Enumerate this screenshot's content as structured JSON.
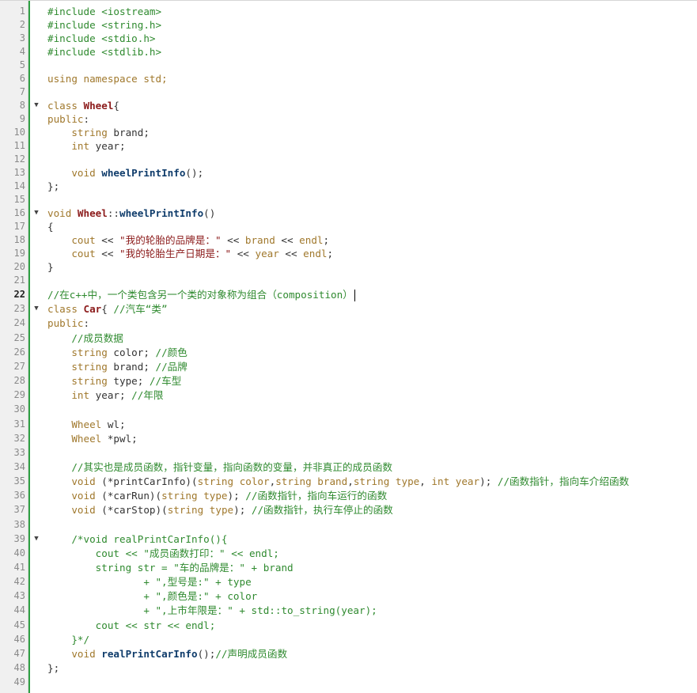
{
  "editor": {
    "current_line": 22,
    "folds": [
      8,
      16,
      23,
      39
    ],
    "lines": [
      [
        {
          "t": "#include <iostream>",
          "c": "pp"
        }
      ],
      [
        {
          "t": "#include <string.h>",
          "c": "pp"
        }
      ],
      [
        {
          "t": "#include <stdio.h>",
          "c": "pp"
        }
      ],
      [
        {
          "t": "#include <stdlib.h>",
          "c": "pp"
        }
      ],
      [],
      [
        {
          "t": "using namespace std;",
          "c": "kw"
        }
      ],
      [],
      [
        {
          "t": "class ",
          "c": "kw"
        },
        {
          "t": "Wheel",
          "c": "cls"
        },
        {
          "t": "{",
          "c": ""
        }
      ],
      [
        {
          "t": "public",
          "c": "kw"
        },
        {
          "t": ":",
          "c": ""
        }
      ],
      [
        {
          "t": "    ",
          "c": ""
        },
        {
          "t": "string",
          "c": "type"
        },
        {
          "t": " brand;",
          "c": ""
        }
      ],
      [
        {
          "t": "    ",
          "c": ""
        },
        {
          "t": "int",
          "c": "type"
        },
        {
          "t": " year;",
          "c": ""
        }
      ],
      [],
      [
        {
          "t": "    ",
          "c": ""
        },
        {
          "t": "void ",
          "c": "type"
        },
        {
          "t": "wheelPrintInfo",
          "c": "fn"
        },
        {
          "t": "();",
          "c": ""
        }
      ],
      [
        {
          "t": "};",
          "c": ""
        }
      ],
      [],
      [
        {
          "t": "void ",
          "c": "type"
        },
        {
          "t": "Wheel",
          "c": "cls"
        },
        {
          "t": "::",
          "c": ""
        },
        {
          "t": "wheelPrintInfo",
          "c": "fn"
        },
        {
          "t": "()",
          "c": ""
        }
      ],
      [
        {
          "t": "{",
          "c": ""
        }
      ],
      [
        {
          "t": "    ",
          "c": ""
        },
        {
          "t": "cout",
          "c": "kw"
        },
        {
          "t": " << ",
          "c": ""
        },
        {
          "t": "\"我的轮胎的品牌是：\"",
          "c": "str"
        },
        {
          "t": " << ",
          "c": ""
        },
        {
          "t": "brand",
          "c": "kw"
        },
        {
          "t": " << ",
          "c": ""
        },
        {
          "t": "endl",
          "c": "kw"
        },
        {
          "t": ";",
          "c": ""
        }
      ],
      [
        {
          "t": "    ",
          "c": ""
        },
        {
          "t": "cout",
          "c": "kw"
        },
        {
          "t": " << ",
          "c": ""
        },
        {
          "t": "\"我的轮胎生产日期是：\"",
          "c": "str"
        },
        {
          "t": " << ",
          "c": ""
        },
        {
          "t": "year",
          "c": "kw"
        },
        {
          "t": " << ",
          "c": ""
        },
        {
          "t": "endl",
          "c": "kw"
        },
        {
          "t": ";",
          "c": ""
        }
      ],
      [
        {
          "t": "}",
          "c": ""
        }
      ],
      [],
      [
        {
          "t": "//在c++中，一个类包含另一个类的对象称为组合（composition）",
          "c": "cm"
        }
      ],
      [
        {
          "t": "class ",
          "c": "kw"
        },
        {
          "t": "Car",
          "c": "cls"
        },
        {
          "t": "{ ",
          "c": ""
        },
        {
          "t": "//汽车“类”",
          "c": "cm"
        }
      ],
      [
        {
          "t": "public",
          "c": "kw"
        },
        {
          "t": ":",
          "c": ""
        }
      ],
      [
        {
          "t": "    ",
          "c": ""
        },
        {
          "t": "//成员数据",
          "c": "cm"
        }
      ],
      [
        {
          "t": "    ",
          "c": ""
        },
        {
          "t": "string",
          "c": "type"
        },
        {
          "t": " color; ",
          "c": ""
        },
        {
          "t": "//颜色",
          "c": "cm"
        }
      ],
      [
        {
          "t": "    ",
          "c": ""
        },
        {
          "t": "string",
          "c": "type"
        },
        {
          "t": " brand; ",
          "c": ""
        },
        {
          "t": "//品牌",
          "c": "cm"
        }
      ],
      [
        {
          "t": "    ",
          "c": ""
        },
        {
          "t": "string",
          "c": "type"
        },
        {
          "t": " type; ",
          "c": ""
        },
        {
          "t": "//车型",
          "c": "cm"
        }
      ],
      [
        {
          "t": "    ",
          "c": ""
        },
        {
          "t": "int",
          "c": "type"
        },
        {
          "t": " year; ",
          "c": ""
        },
        {
          "t": "//年限",
          "c": "cm"
        }
      ],
      [],
      [
        {
          "t": "    ",
          "c": ""
        },
        {
          "t": "Wheel",
          "c": "type"
        },
        {
          "t": " wl;",
          "c": ""
        }
      ],
      [
        {
          "t": "    ",
          "c": ""
        },
        {
          "t": "Wheel",
          "c": "type"
        },
        {
          "t": " *pwl;",
          "c": ""
        }
      ],
      [],
      [
        {
          "t": "    ",
          "c": ""
        },
        {
          "t": "//其实也是成员函数，指针变量，指向函数的变量，并非真正的成员函数",
          "c": "cm"
        }
      ],
      [
        {
          "t": "    ",
          "c": ""
        },
        {
          "t": "void",
          "c": "type"
        },
        {
          "t": " (*printCarInfo)(",
          "c": ""
        },
        {
          "t": "string",
          "c": "type"
        },
        {
          "t": " ",
          "c": ""
        },
        {
          "t": "color",
          "c": "kw"
        },
        {
          "t": ",",
          "c": ""
        },
        {
          "t": "string",
          "c": "type"
        },
        {
          "t": " ",
          "c": ""
        },
        {
          "t": "brand",
          "c": "kw"
        },
        {
          "t": ",",
          "c": ""
        },
        {
          "t": "string",
          "c": "type"
        },
        {
          "t": " ",
          "c": ""
        },
        {
          "t": "type",
          "c": "kw"
        },
        {
          "t": ", ",
          "c": ""
        },
        {
          "t": "int",
          "c": "type"
        },
        {
          "t": " ",
          "c": ""
        },
        {
          "t": "year",
          "c": "kw"
        },
        {
          "t": "); ",
          "c": ""
        },
        {
          "t": "//函数指针，指向车介绍函数",
          "c": "cm"
        }
      ],
      [
        {
          "t": "    ",
          "c": ""
        },
        {
          "t": "void",
          "c": "type"
        },
        {
          "t": " (*carRun)(",
          "c": ""
        },
        {
          "t": "string",
          "c": "type"
        },
        {
          "t": " ",
          "c": ""
        },
        {
          "t": "type",
          "c": "kw"
        },
        {
          "t": "); ",
          "c": ""
        },
        {
          "t": "//函数指针，指向车运行的函数",
          "c": "cm"
        }
      ],
      [
        {
          "t": "    ",
          "c": ""
        },
        {
          "t": "void",
          "c": "type"
        },
        {
          "t": " (*carStop)(",
          "c": ""
        },
        {
          "t": "string",
          "c": "type"
        },
        {
          "t": " ",
          "c": ""
        },
        {
          "t": "type",
          "c": "kw"
        },
        {
          "t": "); ",
          "c": ""
        },
        {
          "t": "//函数指针，执行车停止的函数",
          "c": "cm"
        }
      ],
      [],
      [
        {
          "t": "    /*void realPrintCarInfo(){",
          "c": "cm"
        }
      ],
      [
        {
          "t": "        cout << \"成员函数打印：\" << endl;",
          "c": "cm"
        }
      ],
      [
        {
          "t": "        string str = \"车的品牌是：\" + brand",
          "c": "cm"
        }
      ],
      [
        {
          "t": "                + \",型号是:\" + type",
          "c": "cm"
        }
      ],
      [
        {
          "t": "                + \",颜色是:\" + color",
          "c": "cm"
        }
      ],
      [
        {
          "t": "                + \",上市年限是：\" + std::to_string(year);",
          "c": "cm"
        }
      ],
      [
        {
          "t": "        cout << str << endl;",
          "c": "cm"
        }
      ],
      [
        {
          "t": "    }*/",
          "c": "cm"
        }
      ],
      [
        {
          "t": "    ",
          "c": ""
        },
        {
          "t": "void ",
          "c": "type"
        },
        {
          "t": "realPrintCarInfo",
          "c": "fn"
        },
        {
          "t": "();",
          "c": ""
        },
        {
          "t": "//声明成员函数",
          "c": "cm"
        }
      ],
      [
        {
          "t": "};",
          "c": ""
        }
      ],
      []
    ]
  }
}
